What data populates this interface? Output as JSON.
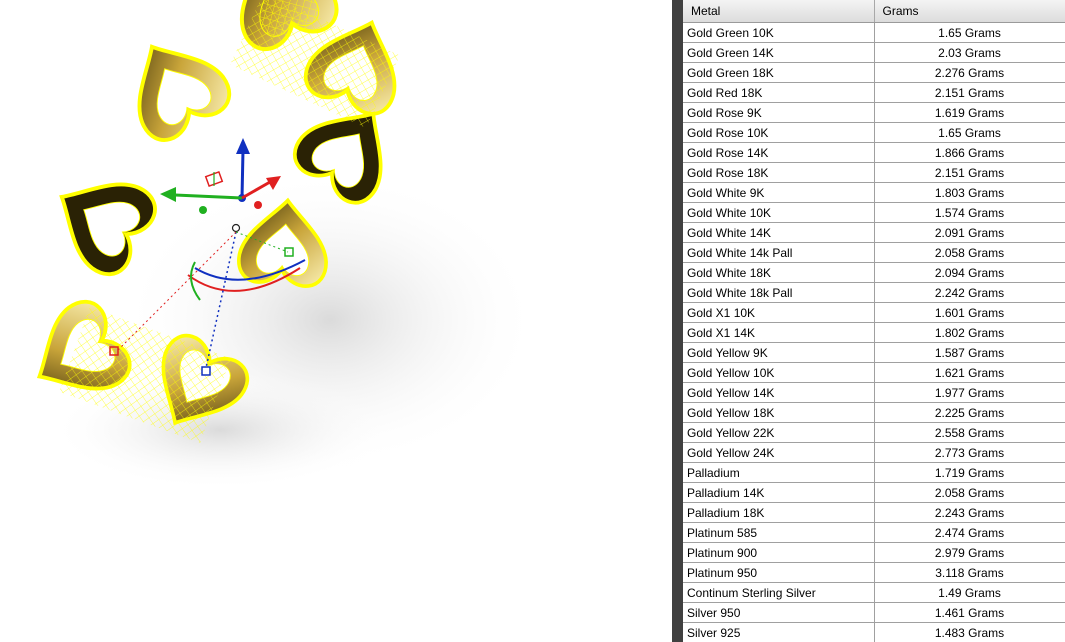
{
  "table": {
    "headers": {
      "metal": "Metal",
      "grams": "Grams"
    },
    "rows": [
      {
        "metal": "Gold Green 10K",
        "grams": "1.65 Grams"
      },
      {
        "metal": "Gold Green 14K",
        "grams": "2.03 Grams"
      },
      {
        "metal": "Gold Green 18K",
        "grams": "2.276 Grams"
      },
      {
        "metal": "Gold Red 18K",
        "grams": "2.151 Grams"
      },
      {
        "metal": "Gold Rose 9K",
        "grams": "1.619 Grams"
      },
      {
        "metal": "Gold Rose 10K",
        "grams": "1.65 Grams"
      },
      {
        "metal": "Gold Rose 14K",
        "grams": "1.866 Grams"
      },
      {
        "metal": "Gold Rose 18K",
        "grams": "2.151 Grams"
      },
      {
        "metal": "Gold White 9K",
        "grams": "1.803 Grams"
      },
      {
        "metal": "Gold White 10K",
        "grams": "1.574 Grams"
      },
      {
        "metal": "Gold White 14K",
        "grams": "2.091 Grams"
      },
      {
        "metal": "Gold White 14k Pall",
        "grams": "2.058 Grams"
      },
      {
        "metal": "Gold White 18K",
        "grams": "2.094 Grams"
      },
      {
        "metal": "Gold White 18k Pall",
        "grams": "2.242 Grams"
      },
      {
        "metal": "Gold X1 10K",
        "grams": "1.601 Grams"
      },
      {
        "metal": "Gold X1 14K",
        "grams": "1.802 Grams"
      },
      {
        "metal": "Gold Yellow 9K",
        "grams": "1.587 Grams"
      },
      {
        "metal": "Gold Yellow 10K",
        "grams": "1.621 Grams"
      },
      {
        "metal": "Gold Yellow 14K",
        "grams": "1.977 Grams"
      },
      {
        "metal": "Gold Yellow 18K",
        "grams": "2.225 Grams"
      },
      {
        "metal": "Gold Yellow 22K",
        "grams": "2.558 Grams"
      },
      {
        "metal": "Gold Yellow 24K",
        "grams": "2.773 Grams"
      },
      {
        "metal": "Palladium",
        "grams": "1.719 Grams"
      },
      {
        "metal": "Palladium 14K",
        "grams": "2.058 Grams"
      },
      {
        "metal": "Palladium 18K",
        "grams": "2.243 Grams"
      },
      {
        "metal": "Platinum 585",
        "grams": "2.474 Grams"
      },
      {
        "metal": "Platinum 900",
        "grams": "2.979 Grams"
      },
      {
        "metal": "Platinum 950",
        "grams": "3.118 Grams"
      },
      {
        "metal": "Continum Sterling Silver",
        "grams": "1.49 Grams"
      },
      {
        "metal": "Silver 950",
        "grams": "1.461 Grams"
      },
      {
        "metal": "Silver 925",
        "grams": "1.483 Grams"
      }
    ]
  },
  "viewport": {
    "object": "heart-ring-model",
    "icons": [
      "gumball-manipulator-icon"
    ],
    "colors": {
      "wireframe": "#ffff00",
      "gold_light": "#f8e9a0",
      "gold_dark": "#2a2205",
      "gumball_x": "#e02020",
      "gumball_y": "#20b020",
      "gumball_z": "#1030c0"
    }
  }
}
